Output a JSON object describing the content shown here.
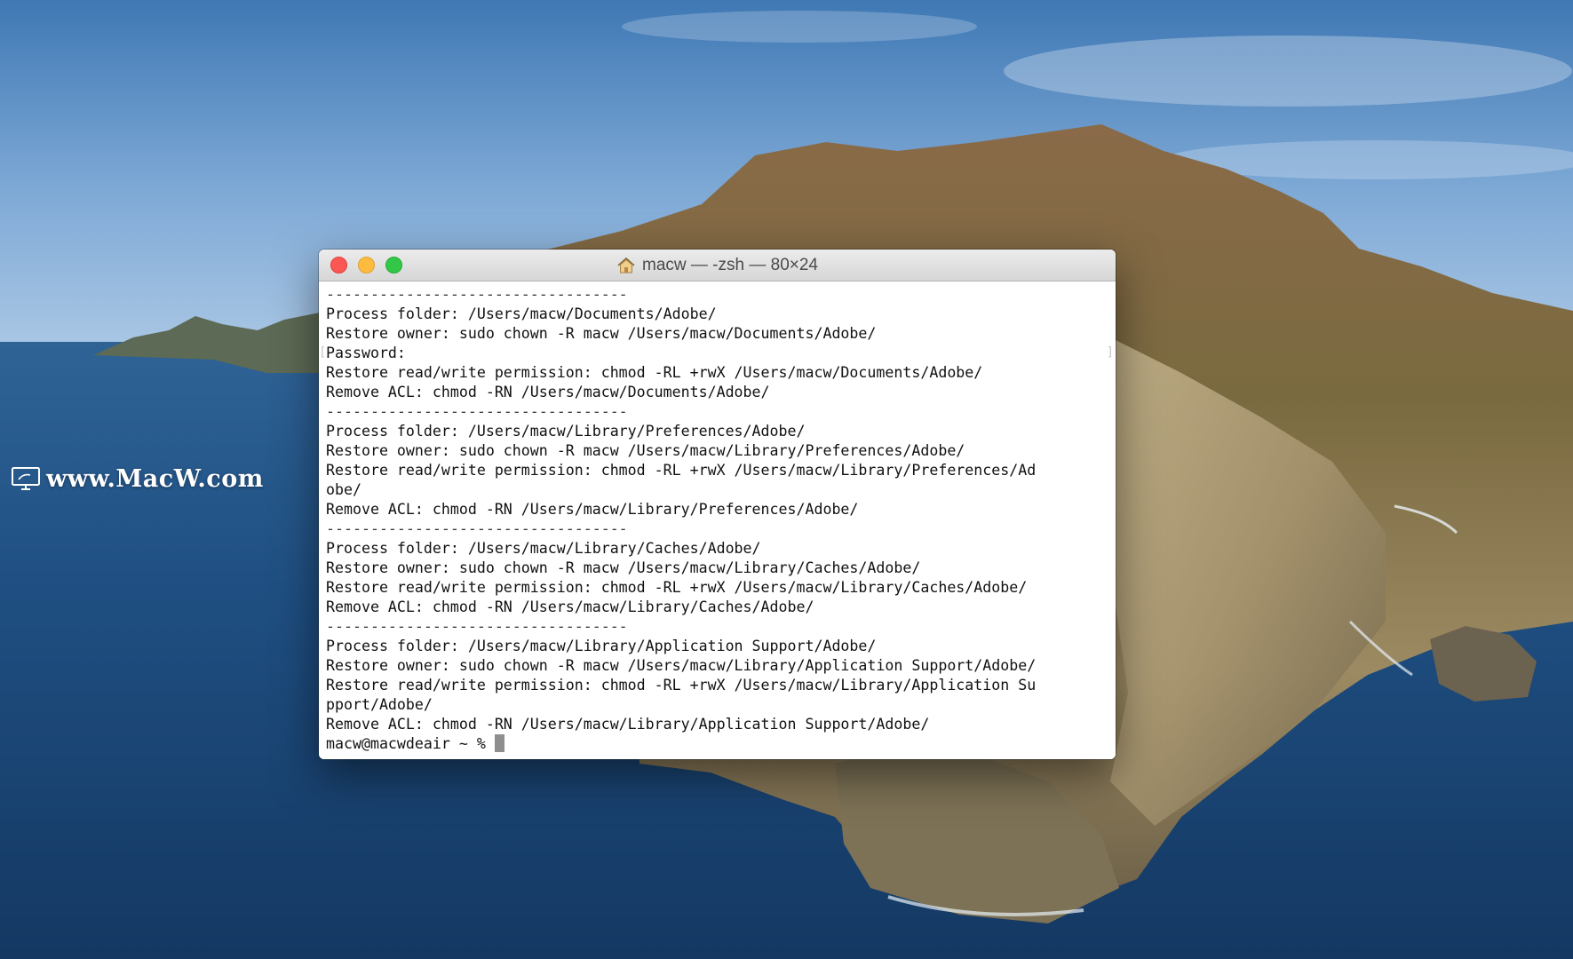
{
  "watermark": {
    "text": "www.MacW.com"
  },
  "window": {
    "title": "macw — -zsh — 80×24",
    "buttons": {
      "close": "close",
      "minimize": "minimize",
      "zoom": "zoom"
    }
  },
  "terminal": {
    "lines": [
      "----------------------------------",
      "Process folder: /Users/macw/Documents/Adobe/",
      "Restore owner: sudo chown -R macw /Users/macw/Documents/Adobe/",
      "Password:",
      "Restore read/write permission: chmod -RL +rwX /Users/macw/Documents/Adobe/",
      "Remove ACL: chmod -RN /Users/macw/Documents/Adobe/",
      "----------------------------------",
      "Process folder: /Users/macw/Library/Preferences/Adobe/",
      "Restore owner: sudo chown -R macw /Users/macw/Library/Preferences/Adobe/",
      "Restore read/write permission: chmod -RL +rwX /Users/macw/Library/Preferences/Ad",
      "obe/",
      "Remove ACL: chmod -RN /Users/macw/Library/Preferences/Adobe/",
      "----------------------------------",
      "Process folder: /Users/macw/Library/Caches/Adobe/",
      "Restore owner: sudo chown -R macw /Users/macw/Library/Caches/Adobe/",
      "Restore read/write permission: chmod -RL +rwX /Users/macw/Library/Caches/Adobe/",
      "Remove ACL: chmod -RN /Users/macw/Library/Caches/Adobe/",
      "----------------------------------",
      "Process folder: /Users/macw/Library/Application Support/Adobe/",
      "Restore owner: sudo chown -R macw /Users/macw/Library/Application Support/Adobe/",
      "Restore read/write permission: chmod -RL +rwX /Users/macw/Library/Application Su",
      "pport/Adobe/",
      "Remove ACL: chmod -RN /Users/macw/Library/Application Support/Adobe/"
    ],
    "prompt": "macw@macwdeair ~ % "
  }
}
